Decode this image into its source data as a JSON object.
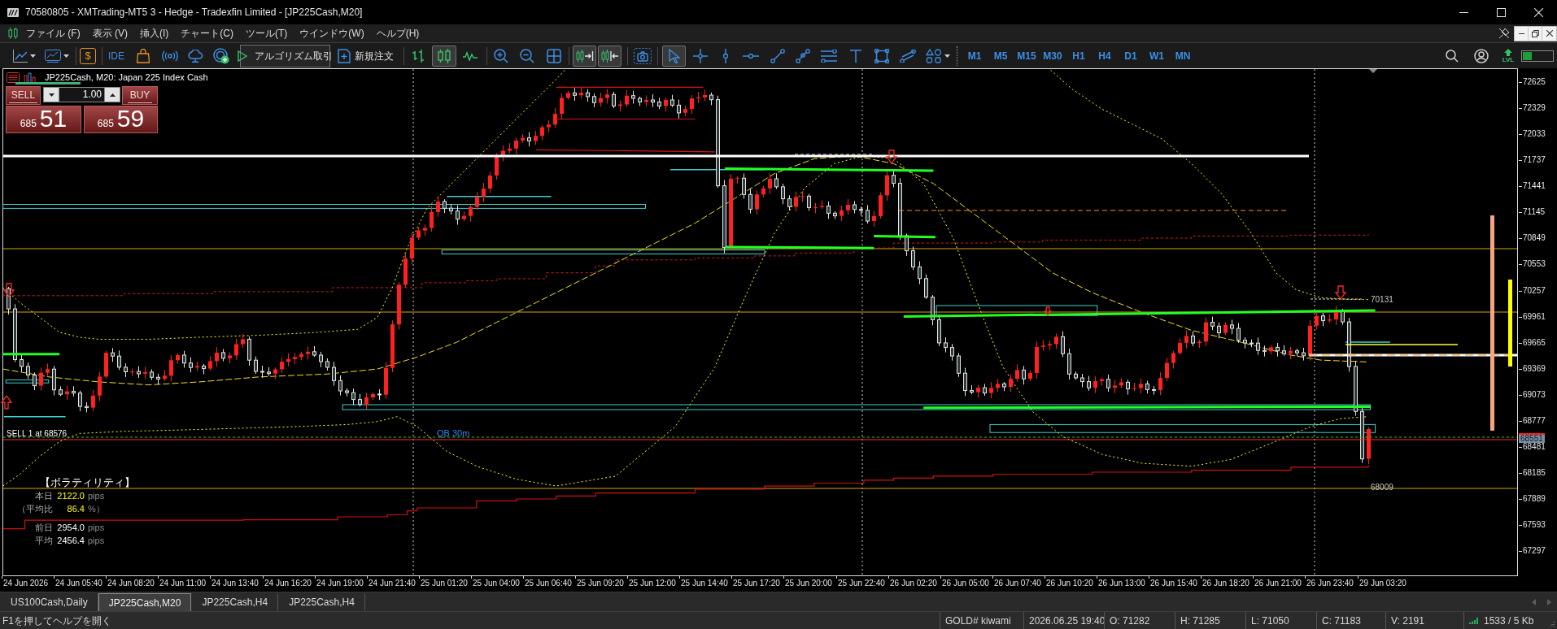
{
  "window": {
    "title": "70580805 - XMTrading-MT5 3 - Hedge - Tradexfin Limited - [JP225Cash,M20]"
  },
  "menu": [
    {
      "label": "ファイル (F)"
    },
    {
      "label": "表示 (V)"
    },
    {
      "label": "挿入(I)"
    },
    {
      "label": "チャート(C)"
    },
    {
      "label": "ツール(T)"
    },
    {
      "label": "ウインドウ(W)"
    },
    {
      "label": "ヘルプ(H)"
    }
  ],
  "toolbar": {
    "currency_symbol": "$",
    "ide_label": "IDE",
    "algo_trading_label": "アルゴリズム取引",
    "new_order_label": "新規注文",
    "chart_types": [
      {
        "selected": false
      },
      {
        "selected": true
      },
      {
        "selected": false
      }
    ],
    "view_toggles": [
      {
        "on": true
      },
      {
        "on": true
      }
    ],
    "tools": [
      {
        "selected": true
      },
      {
        "selected": false
      },
      {
        "selected": false
      },
      {
        "selected": false
      },
      {
        "selected": false
      },
      {
        "selected": false
      },
      {
        "selected": false
      },
      {
        "selected": false
      },
      {
        "selected": false
      },
      {
        "selected": false
      },
      {
        "selected": false
      }
    ],
    "timeframes": [
      {
        "label": "M1"
      },
      {
        "label": "M5"
      },
      {
        "label": "M15"
      },
      {
        "label": "M30"
      },
      {
        "label": "H1"
      },
      {
        "label": "H4"
      },
      {
        "label": "D1"
      },
      {
        "label": "W1"
      },
      {
        "label": "MN"
      }
    ],
    "level_badge": "LVL"
  },
  "chart": {
    "header": "JP225Cash, M20: Japan 225 Index Cash",
    "trade_panel": {
      "sell_label": "SELL",
      "buy_label": "BUY",
      "volume": "1.00",
      "sell_price": {
        "prefix": "685",
        "main": "51"
      },
      "buy_price": {
        "prefix": "685",
        "main": "59"
      }
    },
    "position_label": "SELL 1 at 68576",
    "zone_label": "QB 30m",
    "high_label": "70131",
    "low_label": "68009",
    "volatility": {
      "title": "【ボラティリティ】",
      "rows": [
        {
          "label": "本日",
          "value": "2122.0",
          "unit": "pips",
          "color": "#ffff00"
        },
        {
          "label": "（平均比",
          "value": "86.4",
          "unit": "%）",
          "color": "#ffff00"
        },
        {
          "label": "前日",
          "value": "2954.0",
          "unit": "pips",
          "color": "#ffffff"
        },
        {
          "label": "平均",
          "value": "2456.4",
          "unit": "pips",
          "color": "#ffffff"
        }
      ]
    },
    "price_axis": {
      "labels": [
        "72625",
        "72329",
        "72033",
        "71737",
        "71441",
        "71145",
        "70849",
        "70553",
        "70257",
        "69961",
        "69665",
        "69369",
        "69073",
        "68777",
        "68481",
        "68185",
        "67889",
        "67593",
        "67297"
      ],
      "current_price": "68551"
    },
    "time_axis": {
      "labels": [
        "24 Jun 2026",
        "24 Jun 05:40",
        "24 Jun 08:20",
        "24 Jun 11:00",
        "24 Jun 13:40",
        "24 Jun 16:20",
        "24 Jun 19:00",
        "24 Jun 21:40",
        "25 Jun 01:20",
        "25 Jun 04:00",
        "25 Jun 06:40",
        "25 Jun 09:20",
        "25 Jun 12:00",
        "25 Jun 14:40",
        "25 Jun 17:20",
        "25 Jun 20:00",
        "25 Jun 22:40",
        "26 Jun 02:20",
        "26 Jun 05:00",
        "26 Jun 07:40",
        "26 Jun 10:20",
        "26 Jun 13:00",
        "26 Jun 15:40",
        "26 Jun 18:20",
        "26 Jun 21:00",
        "26 Jun 23:40",
        "29 Jun 03:20"
      ]
    }
  },
  "tabs": [
    {
      "label": "US100Cash,Daily",
      "selected": false
    },
    {
      "label": "JP225Cash,M20",
      "selected": true
    },
    {
      "label": "JP225Cash,H4",
      "selected": false
    },
    {
      "label": "JP225Cash,H4",
      "selected": false
    }
  ],
  "status_bar": {
    "help": "F1を押してヘルプを開く",
    "fields": [
      "GOLD# kiwami",
      "2026.06.25 19:40",
      "O: 71282",
      "H: 71285",
      "L: 71050",
      "C: 71183",
      "V: 2191"
    ],
    "traffic": "1533 / 5 Kb"
  }
}
